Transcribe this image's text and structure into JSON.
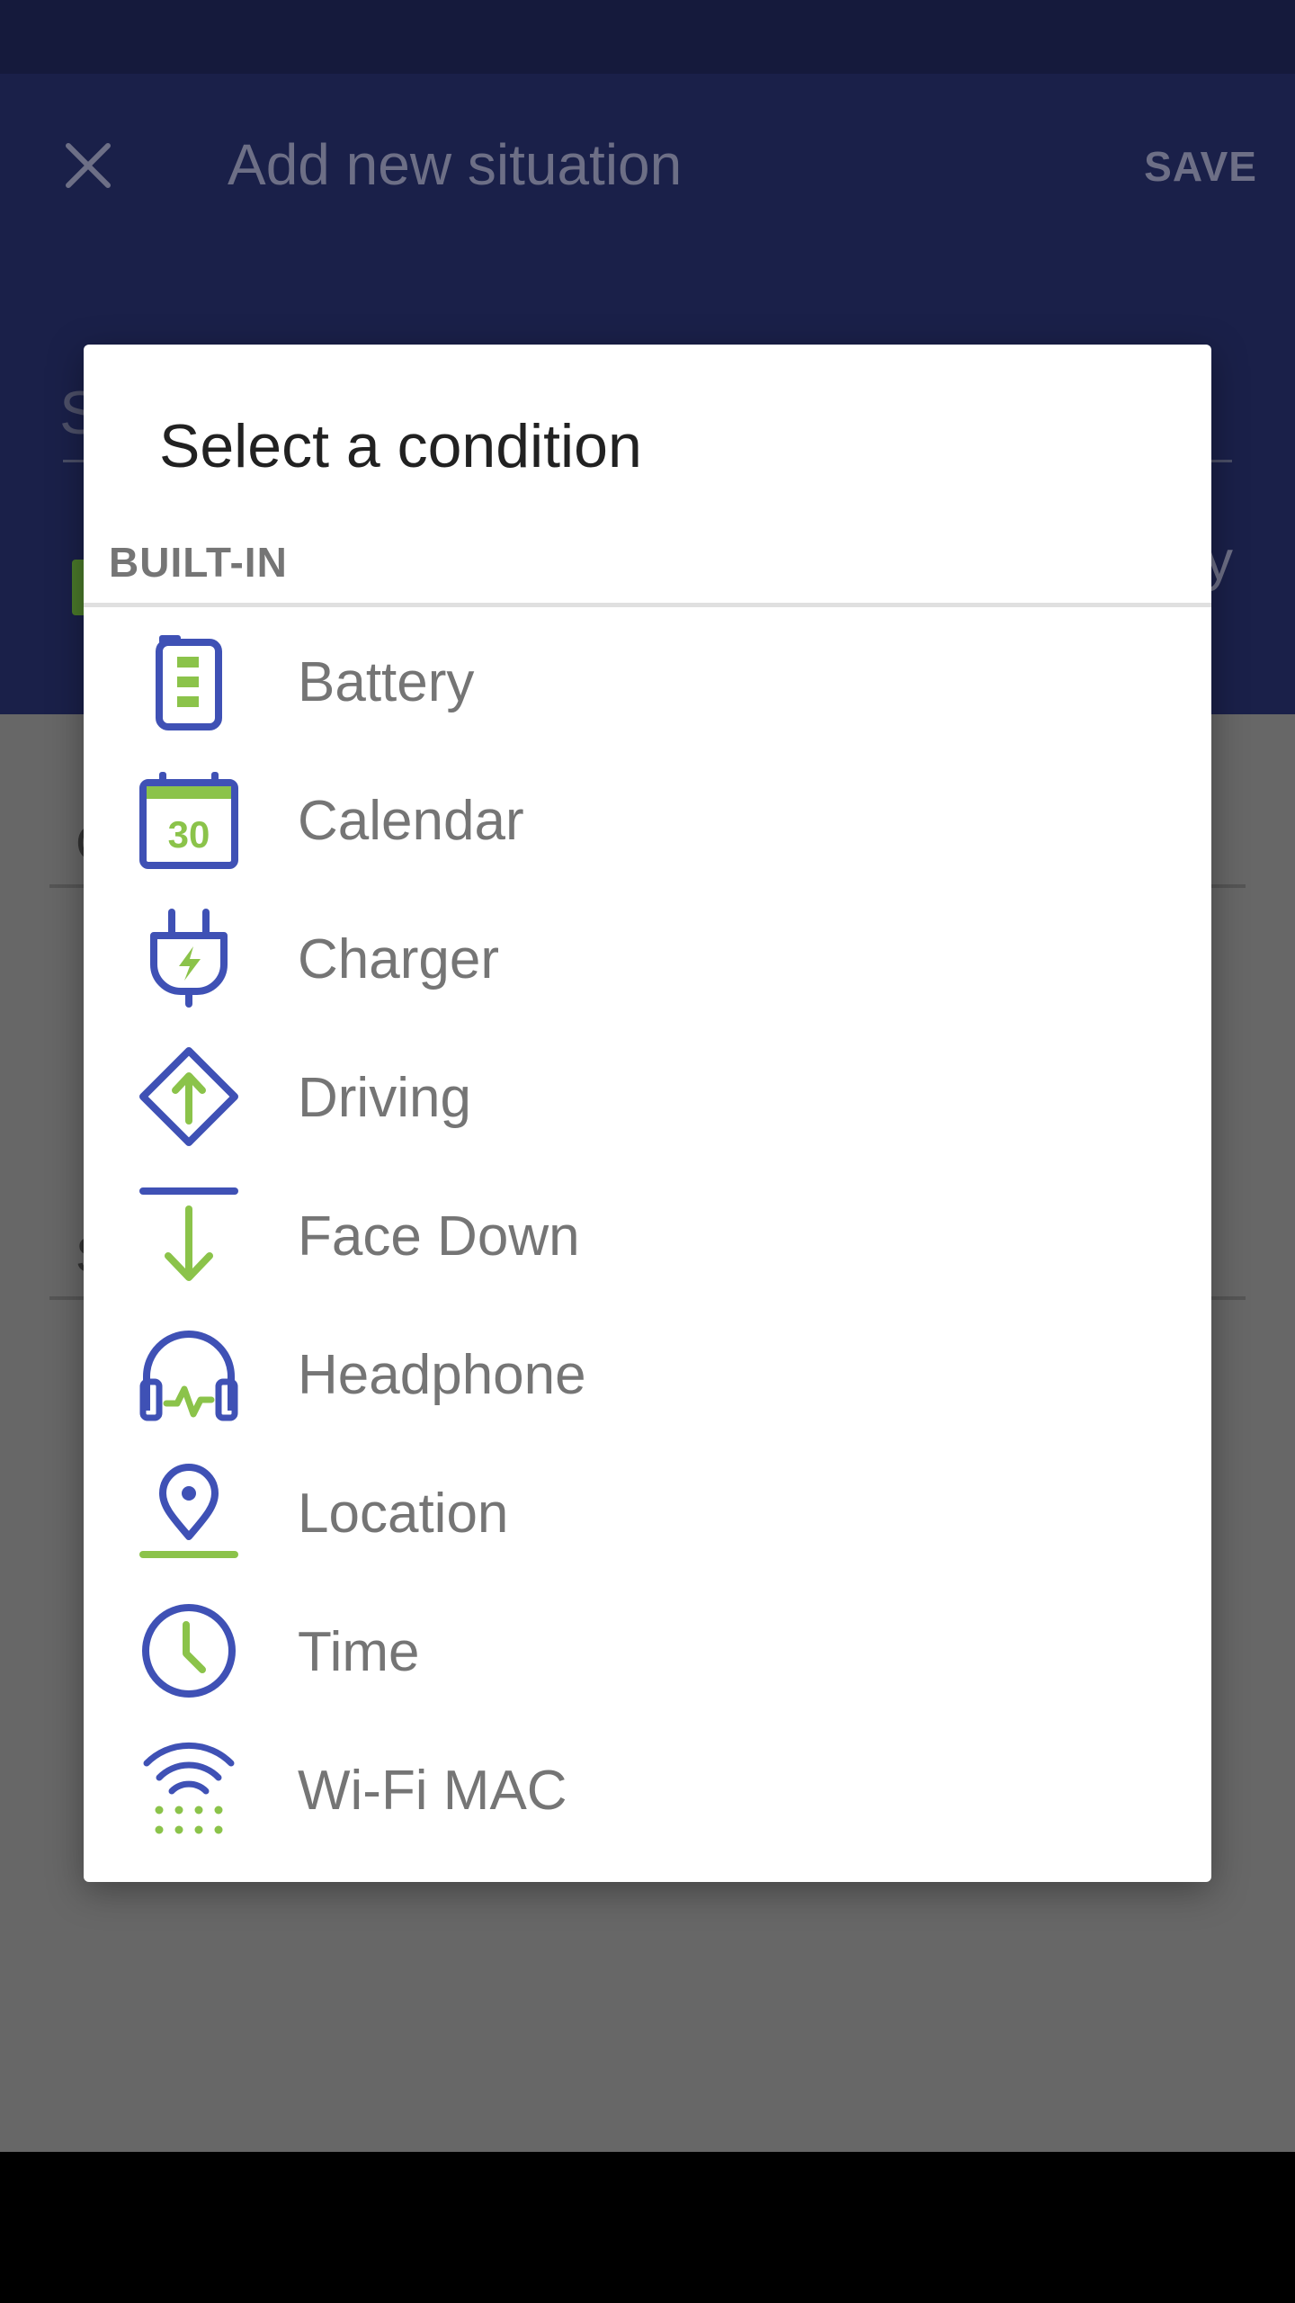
{
  "app": {
    "header_title": "Add new situation",
    "save_label": "SAVE",
    "name_hint": "S",
    "right_partial_text": "y",
    "row1_letter": "C",
    "row2_letter": "S"
  },
  "dialog": {
    "title": "Select a condition",
    "section_header": "BUILT-IN",
    "items": [
      {
        "label": "Battery",
        "icon": "battery-icon"
      },
      {
        "label": "Calendar",
        "icon": "calendar-icon",
        "badge": "30"
      },
      {
        "label": "Charger",
        "icon": "charger-plug-icon"
      },
      {
        "label": "Driving",
        "icon": "driving-sign-icon"
      },
      {
        "label": "Face Down",
        "icon": "face-down-arrow-icon"
      },
      {
        "label": "Headphone",
        "icon": "headphone-icon"
      },
      {
        "label": "Location",
        "icon": "location-pin-icon"
      },
      {
        "label": "Time",
        "icon": "clock-icon"
      },
      {
        "label": "Wi-Fi MAC",
        "icon": "wifi-icon"
      }
    ]
  },
  "colors": {
    "icon_primary": "#3f51b5",
    "icon_accent": "#8bc34a",
    "scrim": "#676767",
    "header_bg": "#1a2049"
  }
}
